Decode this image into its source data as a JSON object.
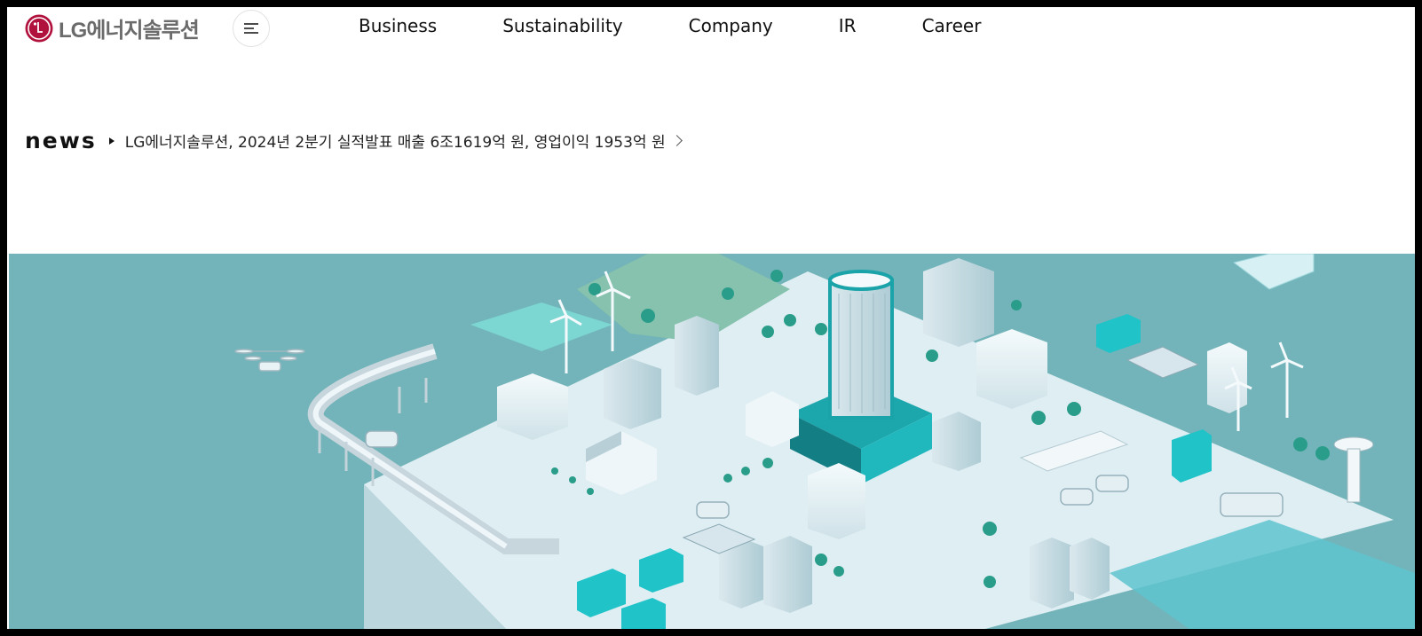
{
  "brand": {
    "logo_text": "LG에너지솔루션"
  },
  "header": {
    "menu_icon": "hamburger-icon",
    "nav": [
      {
        "label": "Business"
      },
      {
        "label": "Sustainability"
      },
      {
        "label": "Company"
      },
      {
        "label": "IR"
      },
      {
        "label": "Career"
      }
    ]
  },
  "news": {
    "label": "news",
    "headline": "LG에너지솔루션, 2024년 2분기 실적발표 매출 6조1619억 원, 영업이익 1953억 원"
  },
  "hero": {
    "illustration": "isometric-smart-city-illustration",
    "colors": {
      "background": "#72b4b9",
      "accent": "#1fc3c8",
      "building": "#e8f2f6"
    }
  }
}
